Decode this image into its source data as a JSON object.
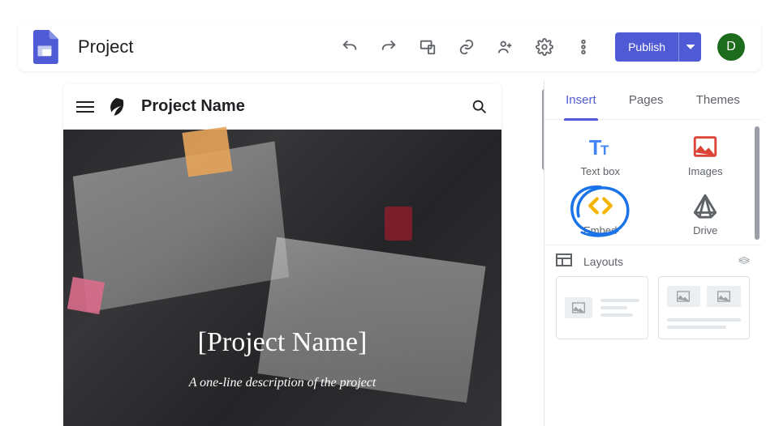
{
  "toolbar": {
    "doc_title": "Project",
    "publish_label": "Publish",
    "avatar_letter": "D"
  },
  "site": {
    "title": "Project Name",
    "hero_title": "[Project Name]",
    "hero_subtitle": "A one-line description of the project"
  },
  "panel": {
    "tabs": {
      "insert": "Insert",
      "pages": "Pages",
      "themes": "Themes"
    },
    "active_tab": "insert",
    "items": {
      "textbox": "Text box",
      "images": "Images",
      "embed": "Embed",
      "drive": "Drive"
    },
    "layouts_label": "Layouts"
  },
  "colors": {
    "primary": "#4f5bd5",
    "embed_icon": "#f4b400",
    "images_icon": "#db4437",
    "scribble": "#1a73e8"
  }
}
